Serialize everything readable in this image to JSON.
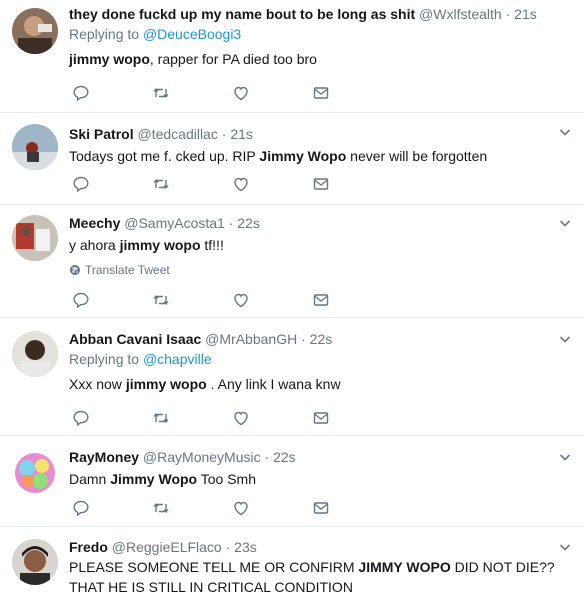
{
  "tweets": [
    {
      "name": "they done fuckd up my name bout to be long as shit",
      "handle": "@Wxlfstealth",
      "dot": "·",
      "time": "21s",
      "replying_prefix": "Replying to",
      "replying_to": "@DeuceBoogi3",
      "text_bold": "jimmy wopo",
      "text_rest": ", rapper for PA died too bro"
    },
    {
      "name": "Ski Patrol",
      "handle": "@tedcadillac",
      "dot": "·",
      "time": "21s",
      "text_pre": "Todays got me f. cked up. RIP ",
      "text_bold": "Jimmy Wopo",
      "text_rest": " never will be forgotten"
    },
    {
      "name": "Meechy",
      "handle": "@SamyAcosta1",
      "dot": "·",
      "time": "22s",
      "text_pre": "y ahora ",
      "text_bold": "jimmy wopo",
      "text_rest": " tf!!!",
      "translate": "Translate Tweet"
    },
    {
      "name": "Abban Cavani Isaac",
      "handle": "@MrAbbanGH",
      "dot": "·",
      "time": "22s",
      "replying_prefix": "Replying to",
      "replying_to": "@chapville",
      "text_pre": "Xxx now ",
      "text_bold": "jimmy wopo",
      "text_rest": " . Any link I wana knw"
    },
    {
      "name": "RayMoney",
      "handle": "@RayMoneyMusic",
      "dot": "·",
      "time": "22s",
      "text_pre": "Damn ",
      "text_bold": "Jimmy Wopo",
      "text_rest": " Too Smh"
    },
    {
      "name": "Fredo",
      "handle": "@ReggieELFlaco",
      "dot": "·",
      "time": "23s",
      "text_pre": "PLEASE SOMEONE TELL ME OR CONFIRM ",
      "text_bold": "JIMMY WOPO",
      "text_rest": " DID NOT DIE?? THAT HE IS STILL IN CRITICAL CONDITION"
    }
  ],
  "colors": {
    "text": "#14171a",
    "muted": "#657786",
    "link": "#1b95e0",
    "icon": "#657786",
    "divider": "#e6ecf0"
  },
  "icons": [
    "reply-icon",
    "retweet-icon",
    "like-icon",
    "direct-message-icon",
    "chevron-down-icon",
    "globe-icon"
  ]
}
